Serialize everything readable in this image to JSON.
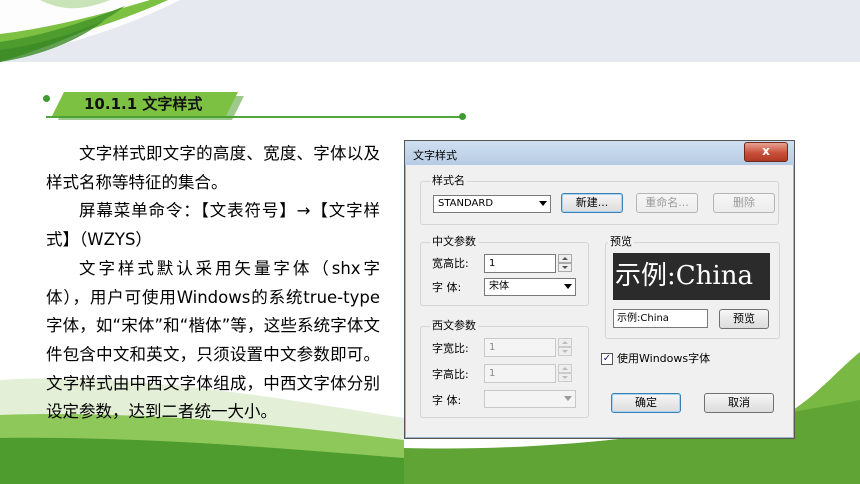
{
  "slide": {
    "section_title": "10.1.1 文字样式",
    "paragraphs": [
      "文字样式即文字的高度、宽度、字体以及样式名称等特征的集合。",
      "屏幕菜单命令：【文表符号】→【文字样式】（WZYS）",
      "文字样式默认采用矢量字体（shx字体），用户可使用Windows的系统true-type字体，如“宋体”和“楷体”等，这些系统字体文件包含中文和英文，只须设置中文参数即可。文字样式由中西文字体组成，中西文字体分别设定参数，达到二者统一大小。"
    ],
    "colors": {
      "green_light": "#7dc143",
      "green_dark": "#4f9c2e",
      "band": "#e6e9ef"
    }
  },
  "dialog": {
    "title": "文字样式",
    "close_label": "x",
    "style_group_label": "样式名",
    "style_selected": "STANDARD",
    "new_button": "新建...",
    "rename_button": "重命名...",
    "delete_button": "删除",
    "cn_group_label": "中文参数",
    "cn_width_label": "宽高比:",
    "cn_width_value": "1",
    "cn_font_label": "字  体:",
    "cn_font_value": "宋体",
    "en_group_label": "西文参数",
    "en_width_label": "字宽比:",
    "en_width_value": "1",
    "en_height_label": "字高比:",
    "en_height_value": "1",
    "en_font_label": "字  体:",
    "en_font_value": "",
    "preview_group_label": "预览",
    "preview_sample": "示例:China",
    "preview_input_value": "示例:China",
    "preview_button": "预览",
    "use_windows_font_label": "使用Windows字体",
    "use_windows_font_checked": "✓",
    "ok_button": "确定",
    "cancel_button": "取消"
  }
}
